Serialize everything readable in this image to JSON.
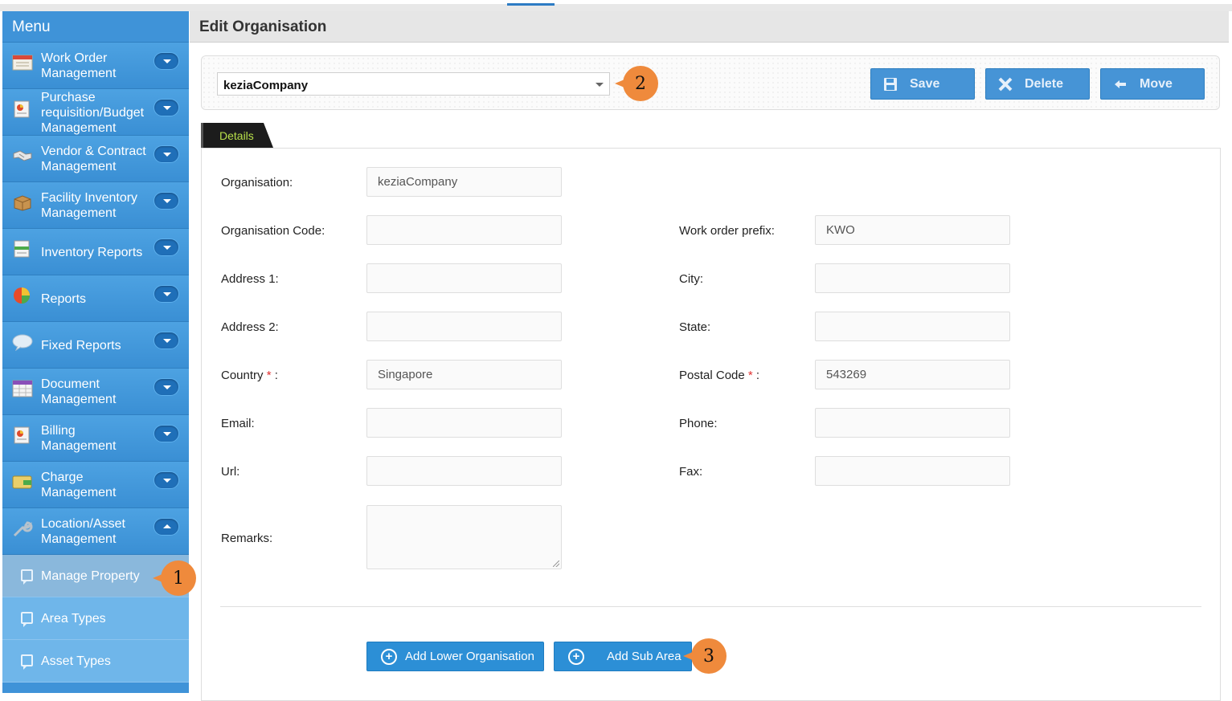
{
  "sidebar": {
    "title": "Menu",
    "items": [
      {
        "label": "Work Order Management",
        "icon": "calendar-icon",
        "color": "#e9e4da"
      },
      {
        "label": "Purchase requisition/Budget Management",
        "icon": "purchase-doc-icon",
        "color": "#f2f2f2"
      },
      {
        "label": "Vendor & Contract Management",
        "icon": "handshake-icon",
        "color": "#d9d9d9"
      },
      {
        "label": "Facility Inventory Management",
        "icon": "box-icon",
        "color": "#c8934e"
      },
      {
        "label": "Inventory Reports",
        "icon": "inventory-report-icon",
        "color": "#f4f4f4"
      },
      {
        "label": "Reports",
        "icon": "pie-chart-icon",
        "color": "#e84b2a"
      },
      {
        "label": "Fixed Reports",
        "icon": "speech-bubble-icon",
        "color": "#e3edf6"
      },
      {
        "label": "Document Management",
        "icon": "calendar-grid-icon",
        "color": "#8a4fb8"
      },
      {
        "label": "Billing Management",
        "icon": "billing-icon",
        "color": "#f2f2f2"
      },
      {
        "label": "Charge Management",
        "icon": "wallet-icon",
        "color": "#e9cf6b"
      },
      {
        "label": "Location/Asset Management",
        "icon": "wrench-icon",
        "color": "#b6c2cc"
      }
    ],
    "sub_items": [
      {
        "label": "Manage Property",
        "active": true
      },
      {
        "label": "Area Types",
        "active": false
      },
      {
        "label": "Asset Types",
        "active": false
      }
    ]
  },
  "header": {
    "title": "Edit Organisation"
  },
  "toolbar": {
    "organisation_select": "keziaCompany",
    "save_label": "Save",
    "delete_label": "Delete",
    "move_label": "Move"
  },
  "tabs": [
    {
      "label": "Details"
    }
  ],
  "form": {
    "organisation_label": "Organisation:",
    "organisation_value": "keziaCompany",
    "org_code_label": "Organisation Code:",
    "org_code_value": "",
    "wo_prefix_label": "Work order prefix:",
    "wo_prefix_value": "KWO",
    "address1_label": "Address 1:",
    "address1_value": "",
    "city_label": "City:",
    "city_value": "",
    "address2_label": "Address 2:",
    "address2_value": "",
    "state_label": "State:",
    "state_value": "",
    "country_label": "Country",
    "country_value": "Singapore",
    "postal_label": "Postal Code",
    "postal_value": "543269",
    "email_label": "Email:",
    "email_value": "",
    "phone_label": "Phone:",
    "phone_value": "",
    "url_label": "Url:",
    "url_value": "",
    "fax_label": "Fax:",
    "fax_value": "",
    "remarks_label": "Remarks:",
    "remarks_value": "",
    "required_mark": "*",
    "colon": ":"
  },
  "actions": {
    "add_lower_org": "Add Lower Organisation",
    "add_sub_area": "Add Sub Area"
  },
  "callouts": [
    "1",
    "2",
    "3"
  ],
  "colors": {
    "accent": "#3f93d8",
    "button": "#4694d6",
    "callout": "#ef8a3c",
    "tab_text": "#b8e04a"
  }
}
